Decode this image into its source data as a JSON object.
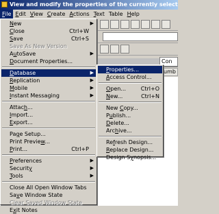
{
  "window": {
    "title": "View and modify the properties of the currently selected database",
    "app_icon": "notes-app-icon"
  },
  "menubar": [
    {
      "label": "File",
      "ul": "F",
      "rest": "ile"
    },
    {
      "label": "Edit",
      "ul": "E",
      "rest": "dit"
    },
    {
      "label": "View",
      "ul": "V",
      "rest": "iew"
    },
    {
      "label": "Create",
      "ul": "C",
      "rest": "reate"
    },
    {
      "label": "Actions",
      "ul": "A",
      "rest": "ctions"
    },
    {
      "label": "Text",
      "ul": "T",
      "rest": "ext"
    },
    {
      "label": "Table",
      "ul": "",
      "rest": "Table"
    },
    {
      "label": "Help",
      "ul": "H",
      "rest": "elp"
    }
  ],
  "file_menu": {
    "new": {
      "pre": "",
      "ul": "N",
      "post": "ew"
    },
    "close": {
      "pre": "",
      "ul": "C",
      "post": "lose",
      "shortcut": "Ctrl+W"
    },
    "save": {
      "pre": "",
      "ul": "S",
      "post": "ave",
      "shortcut": "Ctrl+S"
    },
    "save_as_new_version": {
      "label": "Save As New Version"
    },
    "autosave": {
      "pre": "A",
      "ul": "u",
      "post": "toSave"
    },
    "document_properties": {
      "pre": "",
      "ul": "D",
      "post": "ocument Properties..."
    },
    "database": {
      "pre": "",
      "ul": "D",
      "post": "atabase"
    },
    "replication": {
      "pre": "",
      "ul": "R",
      "post": "eplication"
    },
    "mobile": {
      "pre": "",
      "ul": "M",
      "post": "obile"
    },
    "instant_messaging": {
      "pre": "",
      "ul": "I",
      "post": "nstant Messaging"
    },
    "attach": {
      "pre": "Attac",
      "ul": "h",
      "post": "..."
    },
    "import": {
      "pre": "",
      "ul": "I",
      "post": "mport..."
    },
    "export": {
      "pre": "",
      "ul": "E",
      "post": "xport..."
    },
    "page_setup": {
      "pre": "Pa",
      "ul": "g",
      "post": "e Setup..."
    },
    "print_preview": {
      "pre": "Print Previe",
      "ul": "w",
      "post": "..."
    },
    "print": {
      "pre": "",
      "ul": "P",
      "post": "rint...",
      "shortcut": "Ctrl+P"
    },
    "preferences": {
      "pre": "",
      "ul": "P",
      "post": "references"
    },
    "security": {
      "pre": "Securit",
      "ul": "y",
      "post": ""
    },
    "tools": {
      "pre": "",
      "ul": "T",
      "post": "ools"
    },
    "close_all_open_window_tabs": {
      "pre": "Close All Open Window Tabs",
      "ul": "",
      "post": ""
    },
    "save_window_state": {
      "pre": "Sa",
      "ul": "v",
      "post": "e Window State"
    },
    "clear_saved_window_state": {
      "label": "Clear Saved Window State"
    },
    "exit_notes": {
      "pre": "E",
      "ul": "x",
      "post": "it Notes"
    }
  },
  "database_menu": {
    "properties": {
      "pre": "",
      "ul": "P",
      "post": "roperties..."
    },
    "access_control": {
      "pre": "",
      "ul": "A",
      "post": "ccess Control..."
    },
    "open": {
      "pre": "",
      "ul": "O",
      "post": "pen...",
      "shortcut": "Ctrl+O"
    },
    "new": {
      "pre": "",
      "ul": "N",
      "post": "ew...",
      "shortcut": "Ctrl+N"
    },
    "new_copy": {
      "pre": "New ",
      "ul": "C",
      "post": "opy..."
    },
    "publish": {
      "pre": "P",
      "ul": "u",
      "post": "blish..."
    },
    "delete": {
      "pre": "",
      "ul": "D",
      "post": "elete..."
    },
    "archive": {
      "pre": "Arc",
      "ul": "h",
      "post": "ive..."
    },
    "refresh_design": {
      "pre": "Re",
      "ul": "f",
      "post": "resh Design..."
    },
    "replace_design": {
      "pre": "",
      "ul": "R",
      "post": "eplace Design..."
    },
    "design_synopsis": {
      "pre": "Design S",
      "ul": "y",
      "post": "nopsis..."
    }
  },
  "background": {
    "tab_label": "Con",
    "column_header": "umb",
    "toolbar_field_text": "Design Synops"
  },
  "colors": {
    "highlight": "#0a246a",
    "face": "#d4d0c8",
    "disabled": "#808080"
  }
}
